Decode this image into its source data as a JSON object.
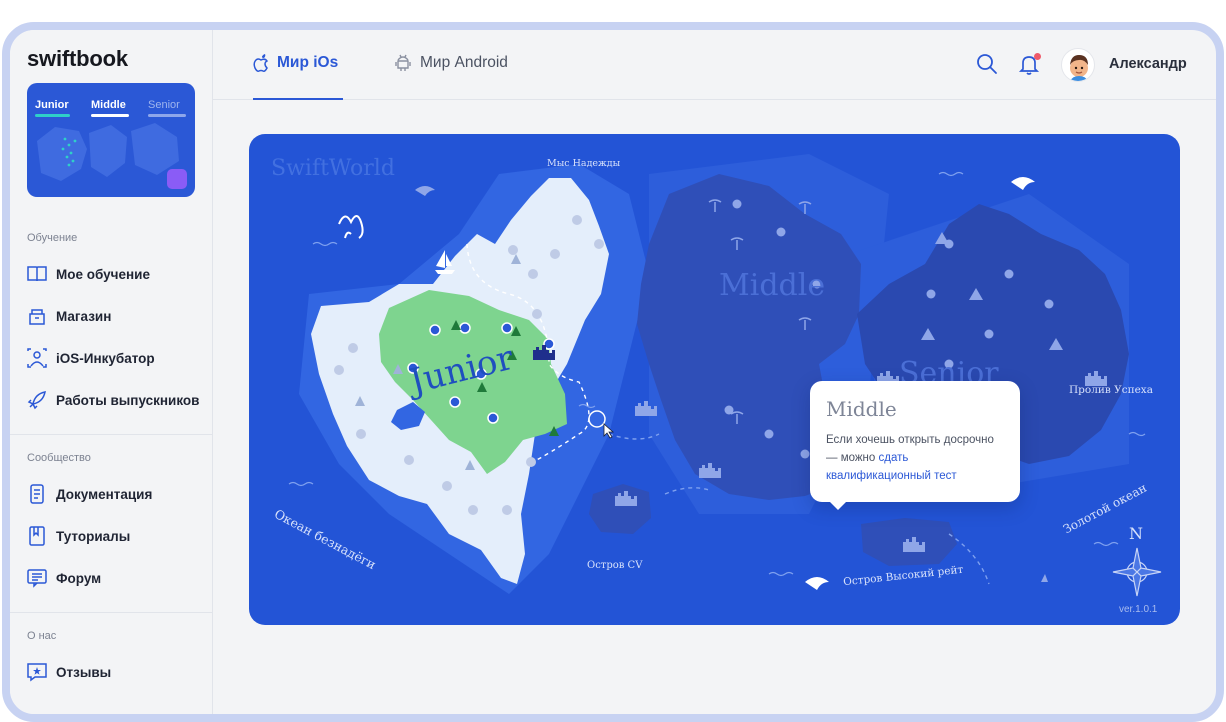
{
  "brand": {
    "logo": "swiftbook"
  },
  "mini_map": {
    "tabs": [
      "Junior",
      "Middle",
      "Senior"
    ],
    "colors": {
      "junior_line": "#2fd0c8",
      "middle_line": "#ffffff",
      "senior_line": "#8ea6ea"
    }
  },
  "sidebar": {
    "sections": [
      {
        "title": "Обучение",
        "items": [
          {
            "label": "Мое обучение",
            "icon": "book-icon"
          },
          {
            "label": "Магазин",
            "icon": "shop-icon"
          },
          {
            "label": "iOS-Инкубатор",
            "icon": "incubator-icon"
          },
          {
            "label": "Работы выпускников",
            "icon": "rocket-icon"
          }
        ]
      },
      {
        "title": "Сообщество",
        "items": [
          {
            "label": "Документация",
            "icon": "document-icon"
          },
          {
            "label": "Туториалы",
            "icon": "tutorial-icon"
          },
          {
            "label": "Форум",
            "icon": "forum-icon"
          }
        ]
      },
      {
        "title": "О нас",
        "items": [
          {
            "label": "Отзывы",
            "icon": "reviews-icon"
          }
        ]
      }
    ]
  },
  "header": {
    "tabs": [
      {
        "label": "Мир iOs",
        "icon": "apple-icon",
        "active": true
      },
      {
        "label": "Мир Android",
        "icon": "android-icon",
        "active": false
      }
    ],
    "user_name": "Александр",
    "has_notifications": true
  },
  "map": {
    "title": "SwiftWorld",
    "regions": {
      "junior": "Junior",
      "middle": "Middle",
      "senior": "Senior"
    },
    "labels": {
      "cape": "Мыс Надежды",
      "ocean_left": "Океан безнадёги",
      "island_cv": "Остров CV",
      "island_reit": "Остров Высокий рейт",
      "strait": "Пролив Успеха",
      "ocean_right": "Золотой океан",
      "compass_n": "N"
    },
    "version": "ver.1.0.1",
    "colors": {
      "sea": "#2354d6",
      "junior": "#7ed48f",
      "junior_land": "#e4eefb",
      "middle_land": "#2f4fb8",
      "senior_land": "#2a49b0"
    }
  },
  "popup": {
    "title": "Middle",
    "text": "Если хочешь открыть досрочно — можно ",
    "link": "сдать квалификационный тест"
  }
}
